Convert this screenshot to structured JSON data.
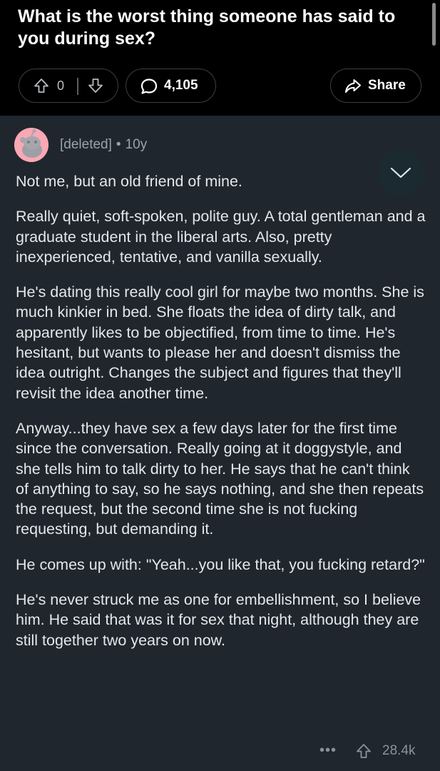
{
  "post": {
    "title": "What is the worst thing someone has said to you during sex?",
    "vote_count": "0",
    "comment_count": "4,105",
    "share_label": "Share"
  },
  "comment": {
    "author": "[deleted]",
    "separator": "•",
    "age": "10y",
    "paragraphs": [
      "Not me, but an old friend of mine.",
      "Really quiet, soft-spoken, polite guy. A total gentleman and a graduate student in the liberal arts. Also, pretty inexperienced, tentative, and vanilla sexually.",
      "He's dating this really cool girl for maybe two months. She is much kinkier in bed. She floats the idea of dirty talk, and apparently likes to be objectified, from time to time. He's hesitant, but wants to please her and doesn't dismiss the idea outright. Changes the subject and figures that they'll revisit the idea another time.",
      "Anyway...they have sex a few days later for the first time since the conversation. Really going at it doggystyle, and she tells him to talk dirty to her. He says that he can't think of anything to say, so he says nothing, and she then repeats the request, but the second time she is not fucking requesting, but demanding it.",
      "He comes up with: \"Yeah...you like that, you fucking retard?\"",
      "He's never struck me as one for embellishment, so I believe him. He said that was it for sex that night, although they are still together two years on now."
    ],
    "more_label": "•••",
    "score": "28.4k"
  },
  "icons": {
    "upvote": "arrow-up-icon",
    "downvote": "arrow-down-icon",
    "comments": "speech-bubble-icon",
    "share": "share-arrow-icon",
    "collapse": "chevron-down-icon",
    "avatar": "snoo-avatar"
  },
  "colors": {
    "background": "#000000",
    "comment_panel": "#1f262e",
    "avatar": "#f9a8b4",
    "text": "#e4e7ea",
    "muted": "#9aa3ad"
  }
}
